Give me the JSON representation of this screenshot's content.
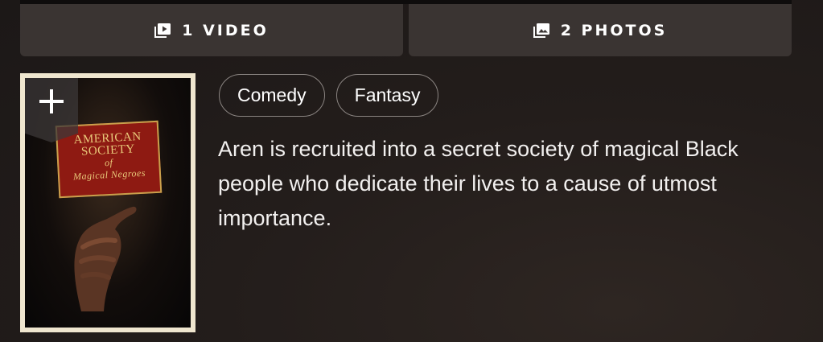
{
  "media": {
    "video_label": "1 VIDEO",
    "photos_label": "2 PHOTOS",
    "video_icon": "video-library-icon",
    "photos_icon": "photo-library-icon"
  },
  "poster": {
    "add_icon": "plus-icon",
    "card_lines": [
      "AMERICAN",
      "SOCIETY",
      "of",
      "Magical Negroes"
    ]
  },
  "genres": [
    "Comedy",
    "Fantasy"
  ],
  "plot": "Aren is recruited into a secret society of magical Black people who dedicate their lives to a cause of utmost importance."
}
